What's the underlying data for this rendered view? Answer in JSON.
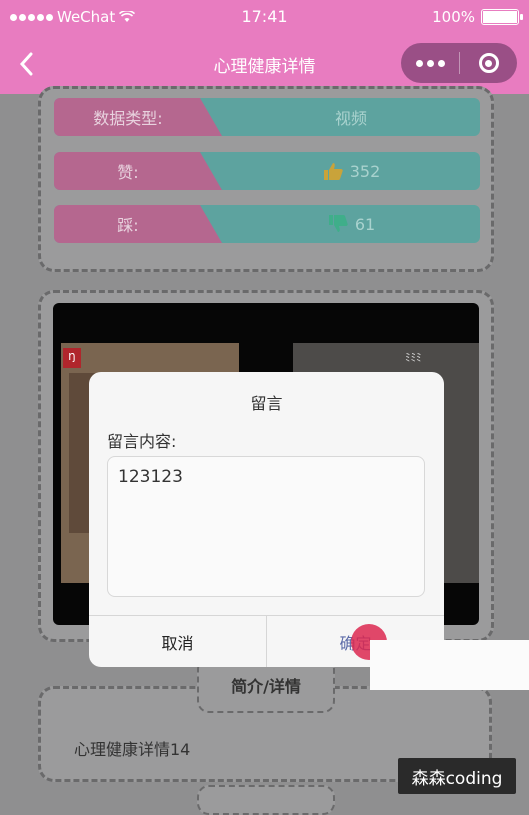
{
  "status": {
    "carrier": "WeChat",
    "time": "17:41",
    "battery": "100%",
    "battery_level": 1.0
  },
  "nav": {
    "title": "心理健康详情"
  },
  "info_rows": [
    {
      "label": "数据类型:",
      "value": "视频",
      "icon": ""
    },
    {
      "label": "赞:",
      "value": "352",
      "icon": "thumbs-up-icon"
    },
    {
      "label": "踩:",
      "value": "61",
      "icon": "thumbs-down-icon"
    }
  ],
  "colors": {
    "accent": "#e87cc0",
    "label_bg": "#b5678f",
    "value_bg": "#5da39f"
  },
  "modal": {
    "title": "留言",
    "label": "留言内容:",
    "content": "123123",
    "cancel": "取消",
    "confirm": "确定"
  },
  "tabs": {
    "intro_detail": "简介/详情"
  },
  "detail": {
    "text": "心理健康详情14"
  },
  "overlay": {
    "watermark": "森森coding"
  }
}
